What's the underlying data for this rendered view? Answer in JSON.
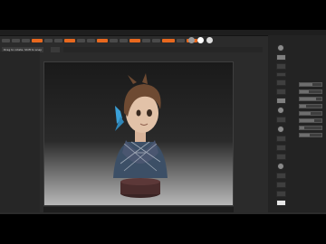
{
  "status": {
    "line1": "Drag to rotate. Shift to snap"
  },
  "menu": {
    "items": [
      "Alpha",
      "Brush",
      "Color",
      "Document",
      "Draw",
      "Edit",
      "File",
      "Layer",
      "Light",
      "Macro",
      "Marker",
      "Material",
      "Movie",
      "Picker",
      "Preferences",
      "Render",
      "Stencil",
      "Stroke",
      "Texture",
      "Tool",
      "Transform",
      "Zplugin",
      "Zscript"
    ]
  },
  "colors": {
    "accent": "#e8681e",
    "panel": "#2b2b2b",
    "viewport_top": "#1a1a1a",
    "viewport_bottom": "#b8b8b8"
  },
  "canvas": {
    "subject": "stylized anime bust on pedestal"
  },
  "icons": {
    "swatch_gray": "gray-material-icon",
    "swatch_white": "white-material-icon",
    "swatch_light": "light-material-icon"
  }
}
